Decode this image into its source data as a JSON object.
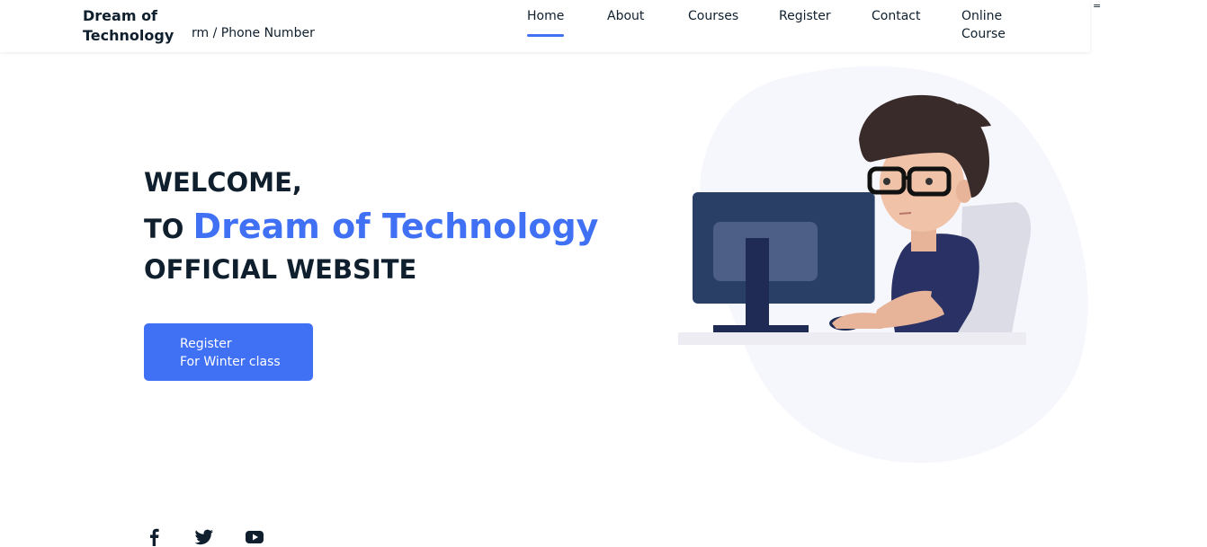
{
  "header": {
    "brand_line1": "Dream of",
    "brand_line2": "Technology",
    "contact_text": "rm / Phone Number",
    "menu_toggle": "=",
    "nav": [
      {
        "label": "Home"
      },
      {
        "label": "About"
      },
      {
        "label": "Courses"
      },
      {
        "label": "Register"
      },
      {
        "label": "Contact"
      },
      {
        "label": "Online",
        "label2": "Course"
      }
    ],
    "active_nav": "Home"
  },
  "hero": {
    "line1": "WELCOME,",
    "line2_prefix": "TO",
    "line2_accent": "Dream of Technology",
    "line3": "OFFICIAL WEBSITE",
    "cta_line1": "Register",
    "cta_line2": "For Winter class"
  },
  "social": [
    {
      "icon": "facebook-icon"
    },
    {
      "icon": "twitter-icon"
    },
    {
      "icon": "youtube-icon"
    }
  ],
  "colors": {
    "accent": "#4070f4",
    "text": "#0f1f2d",
    "blob": "#f6f6fd"
  }
}
